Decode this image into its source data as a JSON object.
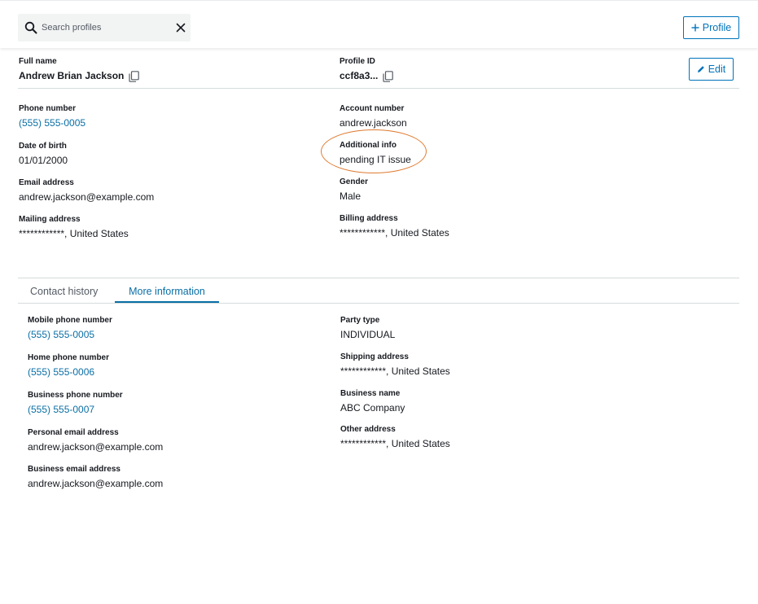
{
  "search": {
    "placeholder": "Search profiles",
    "value": ""
  },
  "header": {
    "add_profile_label": "Profile",
    "edit_label": "Edit"
  },
  "profile": {
    "full_name_label": "Full name",
    "full_name": "Andrew Brian Jackson",
    "profile_id_label": "Profile ID",
    "profile_id": "ccf8a3...",
    "phone_label": "Phone number",
    "phone": "(555) 555-0005",
    "account_label": "Account number",
    "account": "andrew.jackson",
    "dob_label": "Date of birth",
    "dob": "01/01/2000",
    "additional_label": "Additional info",
    "additional": "pending IT issue",
    "email_label": "Email address",
    "email": "andrew.jackson@example.com",
    "gender_label": "Gender",
    "gender": "Male",
    "mailing_label": "Mailing address",
    "mailing": "************, United States",
    "billing_label": "Billing address",
    "billing": "************, United States"
  },
  "tabs": [
    {
      "label": "Contact history",
      "active": false
    },
    {
      "label": "More information",
      "active": true
    }
  ],
  "more_info": {
    "left": [
      {
        "label": "Mobile phone number",
        "value": "(555) 555-0005",
        "link": true
      },
      {
        "label": "Home phone number",
        "value": "(555) 555-0006",
        "link": true
      },
      {
        "label": "Business phone number",
        "value": "(555) 555-0007",
        "link": true
      },
      {
        "label": "Personal email address",
        "value": "andrew.jackson@example.com",
        "link": false
      },
      {
        "label": "Business email address",
        "value": "andrew.jackson@example.com",
        "link": false
      }
    ],
    "right": [
      {
        "label": "Party type",
        "value": "INDIVIDUAL"
      },
      {
        "label": "Shipping address",
        "value": "************, United States"
      },
      {
        "label": "Business name",
        "value": "ABC Company"
      },
      {
        "label": "Other address",
        "value": "************, United States"
      }
    ]
  },
  "colors": {
    "accent": "#0073bb",
    "link": "#0a6fa6",
    "highlight": "#e07a2f"
  },
  "icons": [
    "search-icon",
    "close-icon",
    "plus-icon",
    "pencil-icon",
    "copy-icon"
  ]
}
